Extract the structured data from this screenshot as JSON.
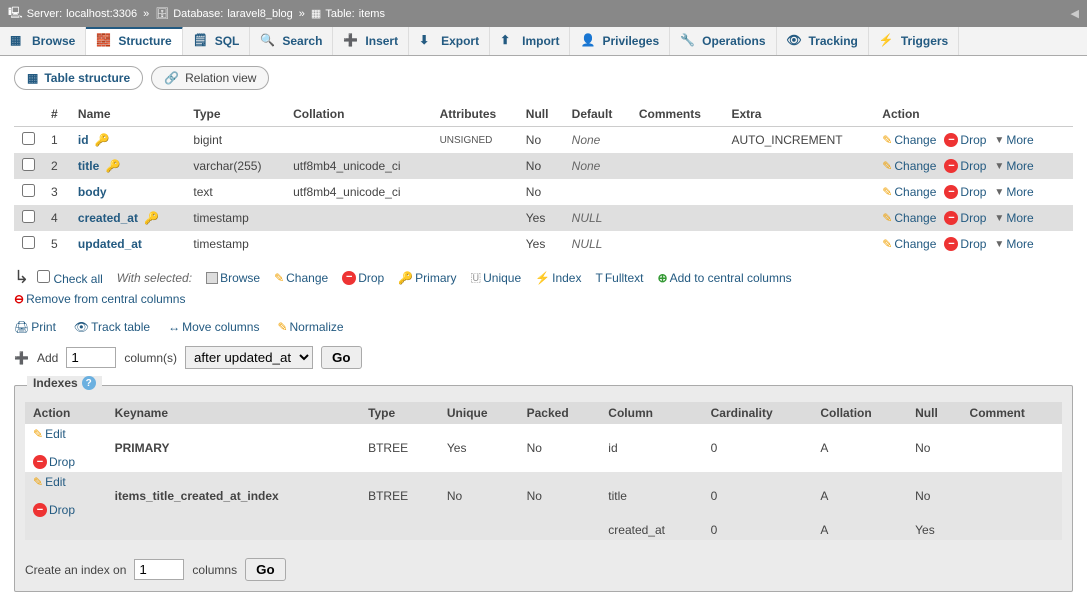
{
  "breadcrumb": {
    "server_label": "Server:",
    "server": "localhost:3306",
    "db_label": "Database:",
    "db": "laravel8_blog",
    "table_label": "Table:",
    "table": "items"
  },
  "tabs": [
    {
      "label": "Browse"
    },
    {
      "label": "Structure"
    },
    {
      "label": "SQL"
    },
    {
      "label": "Search"
    },
    {
      "label": "Insert"
    },
    {
      "label": "Export"
    },
    {
      "label": "Import"
    },
    {
      "label": "Privileges"
    },
    {
      "label": "Operations"
    },
    {
      "label": "Tracking"
    },
    {
      "label": "Triggers"
    }
  ],
  "subtabs": {
    "structure": "Table structure",
    "relation": "Relation view"
  },
  "headers": {
    "num": "#",
    "name": "Name",
    "type": "Type",
    "collation": "Collation",
    "attributes": "Attributes",
    "null": "Null",
    "default": "Default",
    "comments": "Comments",
    "extra": "Extra",
    "action": "Action"
  },
  "columns": [
    {
      "num": "1",
      "name": "id",
      "key": "primary",
      "type": "bigint",
      "collation": "",
      "attr": "UNSIGNED",
      "null": "No",
      "default": "None",
      "extra": "AUTO_INCREMENT"
    },
    {
      "num": "2",
      "name": "title",
      "key": "index",
      "type": "varchar(255)",
      "collation": "utf8mb4_unicode_ci",
      "attr": "",
      "null": "No",
      "default": "None",
      "extra": ""
    },
    {
      "num": "3",
      "name": "body",
      "key": "",
      "type": "text",
      "collation": "utf8mb4_unicode_ci",
      "attr": "",
      "null": "No",
      "default": "",
      "extra": ""
    },
    {
      "num": "4",
      "name": "created_at",
      "key": "index",
      "type": "timestamp",
      "collation": "",
      "attr": "",
      "null": "Yes",
      "default": "NULL",
      "extra": ""
    },
    {
      "num": "5",
      "name": "updated_at",
      "key": "",
      "type": "timestamp",
      "collation": "",
      "attr": "",
      "null": "Yes",
      "default": "NULL",
      "extra": ""
    }
  ],
  "row_actions": {
    "change": "Change",
    "drop": "Drop",
    "more": "More"
  },
  "toolbar": {
    "checkall": "Check all",
    "withsel": "With selected:",
    "browse": "Browse",
    "change": "Change",
    "drop": "Drop",
    "primary": "Primary",
    "unique": "Unique",
    "index": "Index",
    "fulltext": "Fulltext",
    "addcentral": "Add to central columns",
    "removecentral": "Remove from central columns"
  },
  "secondary": {
    "print": "Print",
    "track": "Track table",
    "move": "Move columns",
    "normalize": "Normalize"
  },
  "addcols": {
    "add": "Add",
    "count": "1",
    "cols": "column(s)",
    "pos": "after updated_at",
    "go": "Go"
  },
  "indexes_panel": {
    "title": "Indexes",
    "headers": {
      "action": "Action",
      "keyname": "Keyname",
      "type": "Type",
      "unique": "Unique",
      "packed": "Packed",
      "column": "Column",
      "cardinality": "Cardinality",
      "collation": "Collation",
      "null": "Null",
      "comment": "Comment"
    },
    "rows": [
      {
        "keyname": "PRIMARY",
        "type": "BTREE",
        "unique": "Yes",
        "packed": "No",
        "cols": [
          {
            "column": "id",
            "card": "0",
            "coll": "A",
            "null": "No"
          }
        ]
      },
      {
        "keyname": "items_title_created_at_index",
        "type": "BTREE",
        "unique": "No",
        "packed": "No",
        "cols": [
          {
            "column": "title",
            "card": "0",
            "coll": "A",
            "null": "No"
          },
          {
            "column": "created_at",
            "card": "0",
            "coll": "A",
            "null": "Yes"
          }
        ]
      }
    ],
    "actions": {
      "edit": "Edit",
      "drop": "Drop"
    },
    "create": {
      "label1": "Create an index on",
      "count": "1",
      "label2": "columns",
      "go": "Go"
    }
  }
}
